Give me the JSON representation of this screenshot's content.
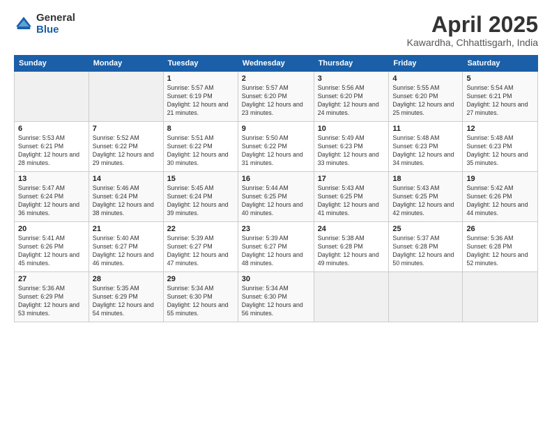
{
  "header": {
    "logo_general": "General",
    "logo_blue": "Blue",
    "title": "April 2025",
    "subtitle": "Kawardha, Chhattisgarh, India"
  },
  "weekdays": [
    "Sunday",
    "Monday",
    "Tuesday",
    "Wednesday",
    "Thursday",
    "Friday",
    "Saturday"
  ],
  "weeks": [
    [
      {
        "day": "",
        "sunrise": "",
        "sunset": "",
        "daylight": ""
      },
      {
        "day": "",
        "sunrise": "",
        "sunset": "",
        "daylight": ""
      },
      {
        "day": "1",
        "sunrise": "Sunrise: 5:57 AM",
        "sunset": "Sunset: 6:19 PM",
        "daylight": "Daylight: 12 hours and 21 minutes."
      },
      {
        "day": "2",
        "sunrise": "Sunrise: 5:57 AM",
        "sunset": "Sunset: 6:20 PM",
        "daylight": "Daylight: 12 hours and 23 minutes."
      },
      {
        "day": "3",
        "sunrise": "Sunrise: 5:56 AM",
        "sunset": "Sunset: 6:20 PM",
        "daylight": "Daylight: 12 hours and 24 minutes."
      },
      {
        "day": "4",
        "sunrise": "Sunrise: 5:55 AM",
        "sunset": "Sunset: 6:20 PM",
        "daylight": "Daylight: 12 hours and 25 minutes."
      },
      {
        "day": "5",
        "sunrise": "Sunrise: 5:54 AM",
        "sunset": "Sunset: 6:21 PM",
        "daylight": "Daylight: 12 hours and 27 minutes."
      }
    ],
    [
      {
        "day": "6",
        "sunrise": "Sunrise: 5:53 AM",
        "sunset": "Sunset: 6:21 PM",
        "daylight": "Daylight: 12 hours and 28 minutes."
      },
      {
        "day": "7",
        "sunrise": "Sunrise: 5:52 AM",
        "sunset": "Sunset: 6:22 PM",
        "daylight": "Daylight: 12 hours and 29 minutes."
      },
      {
        "day": "8",
        "sunrise": "Sunrise: 5:51 AM",
        "sunset": "Sunset: 6:22 PM",
        "daylight": "Daylight: 12 hours and 30 minutes."
      },
      {
        "day": "9",
        "sunrise": "Sunrise: 5:50 AM",
        "sunset": "Sunset: 6:22 PM",
        "daylight": "Daylight: 12 hours and 31 minutes."
      },
      {
        "day": "10",
        "sunrise": "Sunrise: 5:49 AM",
        "sunset": "Sunset: 6:23 PM",
        "daylight": "Daylight: 12 hours and 33 minutes."
      },
      {
        "day": "11",
        "sunrise": "Sunrise: 5:48 AM",
        "sunset": "Sunset: 6:23 PM",
        "daylight": "Daylight: 12 hours and 34 minutes."
      },
      {
        "day": "12",
        "sunrise": "Sunrise: 5:48 AM",
        "sunset": "Sunset: 6:23 PM",
        "daylight": "Daylight: 12 hours and 35 minutes."
      }
    ],
    [
      {
        "day": "13",
        "sunrise": "Sunrise: 5:47 AM",
        "sunset": "Sunset: 6:24 PM",
        "daylight": "Daylight: 12 hours and 36 minutes."
      },
      {
        "day": "14",
        "sunrise": "Sunrise: 5:46 AM",
        "sunset": "Sunset: 6:24 PM",
        "daylight": "Daylight: 12 hours and 38 minutes."
      },
      {
        "day": "15",
        "sunrise": "Sunrise: 5:45 AM",
        "sunset": "Sunset: 6:24 PM",
        "daylight": "Daylight: 12 hours and 39 minutes."
      },
      {
        "day": "16",
        "sunrise": "Sunrise: 5:44 AM",
        "sunset": "Sunset: 6:25 PM",
        "daylight": "Daylight: 12 hours and 40 minutes."
      },
      {
        "day": "17",
        "sunrise": "Sunrise: 5:43 AM",
        "sunset": "Sunset: 6:25 PM",
        "daylight": "Daylight: 12 hours and 41 minutes."
      },
      {
        "day": "18",
        "sunrise": "Sunrise: 5:43 AM",
        "sunset": "Sunset: 6:25 PM",
        "daylight": "Daylight: 12 hours and 42 minutes."
      },
      {
        "day": "19",
        "sunrise": "Sunrise: 5:42 AM",
        "sunset": "Sunset: 6:26 PM",
        "daylight": "Daylight: 12 hours and 44 minutes."
      }
    ],
    [
      {
        "day": "20",
        "sunrise": "Sunrise: 5:41 AM",
        "sunset": "Sunset: 6:26 PM",
        "daylight": "Daylight: 12 hours and 45 minutes."
      },
      {
        "day": "21",
        "sunrise": "Sunrise: 5:40 AM",
        "sunset": "Sunset: 6:27 PM",
        "daylight": "Daylight: 12 hours and 46 minutes."
      },
      {
        "day": "22",
        "sunrise": "Sunrise: 5:39 AM",
        "sunset": "Sunset: 6:27 PM",
        "daylight": "Daylight: 12 hours and 47 minutes."
      },
      {
        "day": "23",
        "sunrise": "Sunrise: 5:39 AM",
        "sunset": "Sunset: 6:27 PM",
        "daylight": "Daylight: 12 hours and 48 minutes."
      },
      {
        "day": "24",
        "sunrise": "Sunrise: 5:38 AM",
        "sunset": "Sunset: 6:28 PM",
        "daylight": "Daylight: 12 hours and 49 minutes."
      },
      {
        "day": "25",
        "sunrise": "Sunrise: 5:37 AM",
        "sunset": "Sunset: 6:28 PM",
        "daylight": "Daylight: 12 hours and 50 minutes."
      },
      {
        "day": "26",
        "sunrise": "Sunrise: 5:36 AM",
        "sunset": "Sunset: 6:28 PM",
        "daylight": "Daylight: 12 hours and 52 minutes."
      }
    ],
    [
      {
        "day": "27",
        "sunrise": "Sunrise: 5:36 AM",
        "sunset": "Sunset: 6:29 PM",
        "daylight": "Daylight: 12 hours and 53 minutes."
      },
      {
        "day": "28",
        "sunrise": "Sunrise: 5:35 AM",
        "sunset": "Sunset: 6:29 PM",
        "daylight": "Daylight: 12 hours and 54 minutes."
      },
      {
        "day": "29",
        "sunrise": "Sunrise: 5:34 AM",
        "sunset": "Sunset: 6:30 PM",
        "daylight": "Daylight: 12 hours and 55 minutes."
      },
      {
        "day": "30",
        "sunrise": "Sunrise: 5:34 AM",
        "sunset": "Sunset: 6:30 PM",
        "daylight": "Daylight: 12 hours and 56 minutes."
      },
      {
        "day": "",
        "sunrise": "",
        "sunset": "",
        "daylight": ""
      },
      {
        "day": "",
        "sunrise": "",
        "sunset": "",
        "daylight": ""
      },
      {
        "day": "",
        "sunrise": "",
        "sunset": "",
        "daylight": ""
      }
    ]
  ]
}
